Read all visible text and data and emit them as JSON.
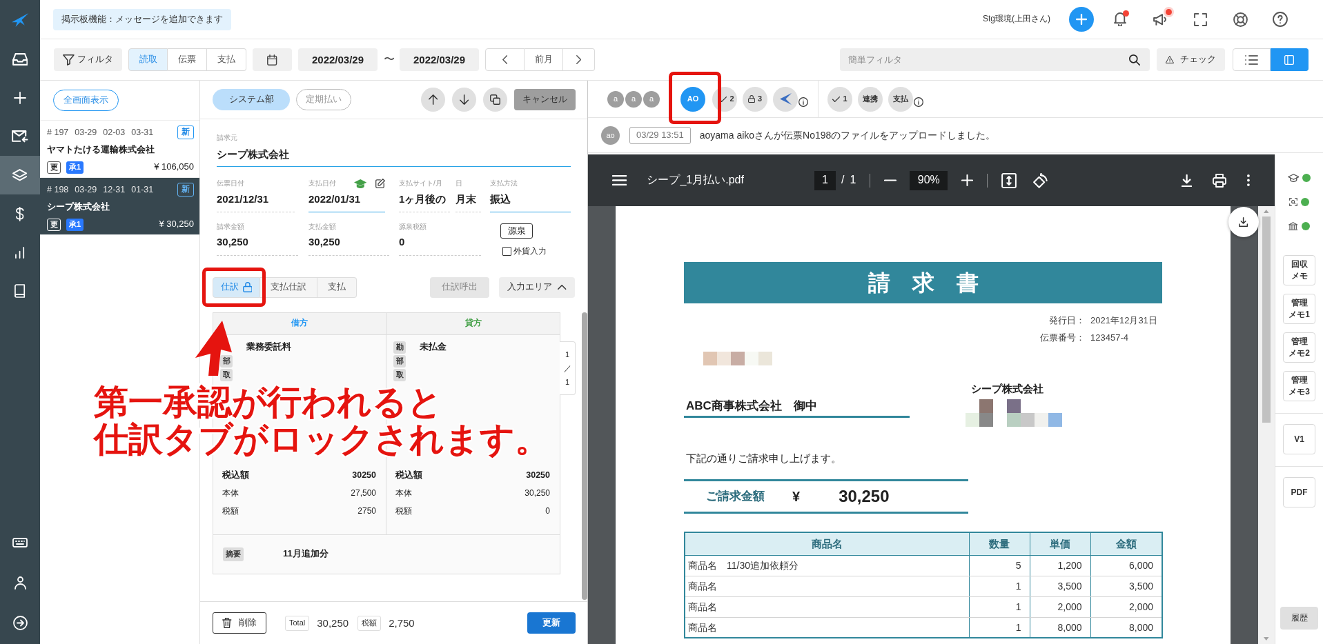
{
  "sidebar": {
    "items": [
      {
        "selected": false
      },
      {
        "selected": false
      },
      {
        "selected": false
      },
      {
        "selected": true
      },
      {
        "selected": false
      },
      {
        "selected": false
      },
      {
        "selected": false
      }
    ]
  },
  "top_bar": {
    "notice": "掲示板機能：メッセージを追加できます",
    "user": "Stg環境(上田さん)",
    "notifications_unread": true,
    "announcements_unread": true
  },
  "toolbar": {
    "filter": "フィルタ",
    "sources": [
      {
        "label": "読取",
        "selected": true
      },
      {
        "label": "伝票",
        "selected": false
      },
      {
        "label": "支払",
        "selected": false
      }
    ],
    "date_from": "2022/03/29",
    "date_separator": "〜",
    "date_to": "2022/03/29",
    "period": "前月",
    "quick_filter": {
      "placeholder": "簡単フィルタ"
    },
    "check": "チェック",
    "views": [
      {
        "selected": false
      },
      {
        "selected": true
      }
    ]
  },
  "list": {
    "fullscreen": "全画面表示",
    "items": [
      {
        "number": "# 197",
        "dates": [
          "03-29",
          "02-03",
          "03-31"
        ],
        "badge": "新",
        "name": "ヤマトたける運輸株式会社",
        "tags": [
          "更"
        ],
        "approval": "承1",
        "amount": "¥ 106,050",
        "selected": false
      },
      {
        "number": "# 198",
        "dates": [
          "03-29",
          "12-31",
          "01-31"
        ],
        "badge": "新",
        "name": "シープ株式会社",
        "tags": [
          "更"
        ],
        "approval": "承1",
        "amount": "¥ 30,250",
        "selected": true
      }
    ]
  },
  "form": {
    "department": "システム部",
    "recurring": "定期払い",
    "cancel": "キャンセル",
    "payee": {
      "label": "請求元",
      "value": "シープ株式会社",
      "highlighted": true
    },
    "dates": [
      {
        "label": "伝票日付",
        "value": "2021/12/31",
        "highlighted": false
      },
      {
        "label": "支払日付",
        "value": "2022/01/31",
        "highlighted": true
      },
      {
        "label": "支払サイト/月",
        "value": "1ヶ月後の",
        "highlighted": false
      },
      {
        "label": "日",
        "value": "月末",
        "highlighted": false
      },
      {
        "label": "支払方法",
        "value": "振込",
        "highlighted": true
      }
    ],
    "amounts": [
      {
        "label": "請求金額",
        "value": "30,250"
      },
      {
        "label": "支払金額",
        "value": "30,250"
      },
      {
        "label": "源泉税額",
        "value": "0"
      }
    ],
    "withholding": "源泉",
    "foreign_currency": {
      "label": "外貨入力",
      "checked": false
    },
    "tabs": [
      {
        "label": "仕訳",
        "selected": true,
        "locked": true
      },
      {
        "label": "支払仕訳",
        "selected": false,
        "locked": false
      },
      {
        "label": "支払",
        "selected": false,
        "locked": false
      }
    ],
    "recall": {
      "label": "仕訳呼出",
      "disabled": true
    },
    "input_area": {
      "label": "入力エリア",
      "expanded": true
    },
    "journal": {
      "debit": {
        "heading": "借方",
        "rows": [
          {
            "value": "業務委託料"
          },
          {
            "tag": "部"
          },
          {
            "tag": "取"
          }
        ],
        "totals": [
          {
            "label": "税込額",
            "value": "30250"
          },
          {
            "label": "本体",
            "value": "27,500"
          },
          {
            "label": "税額",
            "value": "2750"
          }
        ]
      },
      "credit": {
        "heading": "貸方",
        "rows": [
          {
            "tag": "勘",
            "value": "未払金"
          },
          {
            "tag": "部"
          },
          {
            "tag": "取"
          }
        ],
        "totals": [
          {
            "label": "税込額",
            "value": "30250"
          },
          {
            "label": "本体",
            "value": "30,250"
          },
          {
            "label": "税額",
            "value": "0"
          }
        ]
      },
      "summary": {
        "tag": "摘要",
        "value": "11月追加分"
      },
      "pager": [
        "1",
        "／",
        "1"
      ]
    },
    "footer": {
      "delete": "削除",
      "total_tag": "Total",
      "total": "30,250",
      "tax_tag": "税額",
      "tax": "2,750",
      "update": "更新"
    }
  },
  "viewer": {
    "avatars": [
      {
        "initials": "a",
        "active": false
      },
      {
        "initials": "a",
        "active": false
      },
      {
        "initials": "a",
        "active": false
      },
      {
        "initials": "AO",
        "active": true
      }
    ],
    "badges": [
      {
        "kind": "check",
        "count": "2"
      },
      {
        "kind": "lock",
        "count": "3"
      },
      {
        "kind": "logo"
      }
    ],
    "badges_2": [
      {
        "kind": "check",
        "count": "1"
      },
      {
        "kind": "text",
        "text": "連携"
      },
      {
        "kind": "text",
        "text": "支払"
      }
    ],
    "activity": {
      "avatar": "ao",
      "time": "03/29 13:51",
      "message": "aoyama aikoさんが伝票No198のファイルをアップロードしました。"
    }
  },
  "pdf": {
    "filename": "シープ_1月払い.pdf",
    "page": "1",
    "page_separator": "/",
    "page_count": "1",
    "zoom": "90%",
    "invoice": {
      "title": "請　求　書",
      "issue_date_label": "発行日：",
      "issue_date": "2021年12月31日",
      "number_label": "伝票番号：",
      "number": "123457-4",
      "issuer": "シープ株式会社",
      "recipient": "ABC商事株式会社　御中",
      "greeting": "下記の通りご請求申し上げます。",
      "amount_label": "ご請求金額",
      "currency": "¥",
      "amount": "30,250",
      "table": {
        "columns": [
          "商品名",
          "数量",
          "単価",
          "金額"
        ],
        "rows": [
          [
            "商品名　11/30追加依頼分",
            "5",
            "1,200",
            "6,000"
          ],
          [
            "商品名",
            "1",
            "3,500",
            "3,500"
          ],
          [
            "商品名",
            "1",
            "2,000",
            "2,000"
          ],
          [
            "商品名",
            "1",
            "8,000",
            "8,000"
          ]
        ]
      }
    }
  },
  "right_rail": {
    "statuses": [
      {
        "color": "#4caf50"
      },
      {
        "color": "#4caf50"
      },
      {
        "color": "#4caf50"
      }
    ],
    "memos": [
      {
        "lines": [
          "回収",
          "メモ"
        ]
      },
      {
        "lines": [
          "管理",
          "メモ1"
        ]
      },
      {
        "lines": [
          "管理",
          "メモ2"
        ]
      },
      {
        "lines": [
          "管理",
          "メモ3"
        ]
      }
    ],
    "version": "V1",
    "pdf": "PDF",
    "history": "履歴"
  },
  "annotation": {
    "lines": [
      "第一承認が行われると",
      "仕訳タブがロックされます。"
    ]
  }
}
